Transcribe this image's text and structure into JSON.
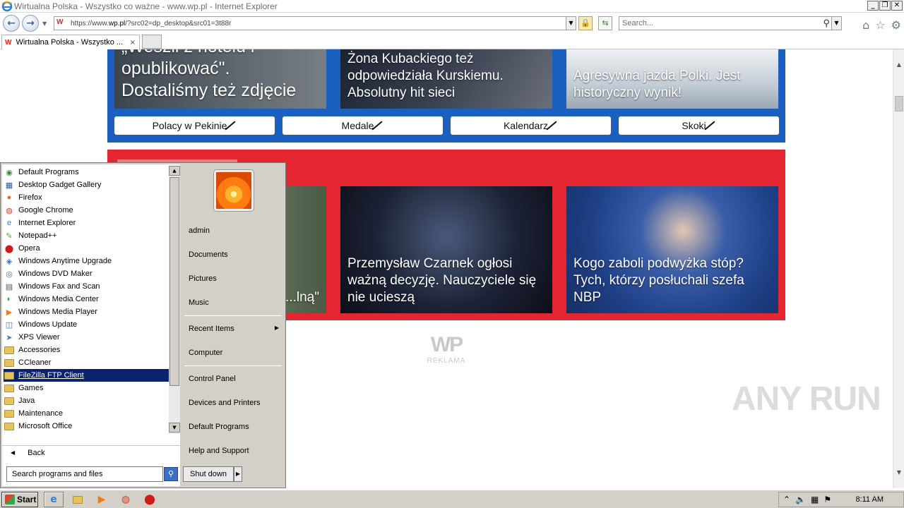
{
  "window": {
    "title": "Wirtualna Polska - Wszystko co ważne - www.wp.pl - Internet Explorer",
    "minimize": "_",
    "maximize": "❐",
    "close": "✕"
  },
  "address": {
    "url_prefix": "https://www.",
    "url_domain": "wp.pl",
    "url_rest": "/?src02=dp_desktop&src01=3t88r"
  },
  "search": {
    "placeholder": "Search..."
  },
  "tab": {
    "title": "Wirtualna Polska - Wszystko ...",
    "close": "×",
    "favicon": "W"
  },
  "page": {
    "sport_cards": [
      {
        "caption": "„Weszli z hotelu i opublikować\". Dostaliśmy też zdjęcie"
      },
      {
        "caption": "Żona Kubackiego też odpowiedziała Kurskiemu. Absolutny hit sieci"
      },
      {
        "caption": "Agresywna jazda Polki. Jest historyczny wynik!"
      }
    ],
    "pills": [
      "Polacy w Pekinie",
      "Medale",
      "Kalendarz",
      "Skoki"
    ],
    "news_cards": [
      {
        "caption": "...nę. ...lną\""
      },
      {
        "caption": "Przemysław Czarnek ogłosi ważną decyzję. Nauczyciele się nie ucieszą"
      },
      {
        "caption": "Kogo zaboli podwyżka stóp? Tych, którzy posłuchali szefa NBP"
      }
    ],
    "ad_logo": "WP",
    "ad_label": "REKLAMA"
  },
  "watermark": "ANY RUN",
  "start_menu": {
    "programs": [
      {
        "label": "Default Programs",
        "icon": "default-programs-icon"
      },
      {
        "label": "Desktop Gadget Gallery",
        "icon": "gadget-icon"
      },
      {
        "label": "Firefox",
        "icon": "firefox-icon"
      },
      {
        "label": "Google Chrome",
        "icon": "chrome-icon"
      },
      {
        "label": "Internet Explorer",
        "icon": "ie-icon"
      },
      {
        "label": "Notepad++",
        "icon": "notepadpp-icon"
      },
      {
        "label": "Opera",
        "icon": "opera-icon"
      },
      {
        "label": "Windows Anytime Upgrade",
        "icon": "windows-icon"
      },
      {
        "label": "Windows DVD Maker",
        "icon": "dvd-icon"
      },
      {
        "label": "Windows Fax and Scan",
        "icon": "fax-icon"
      },
      {
        "label": "Windows Media Center",
        "icon": "media-center-icon"
      },
      {
        "label": "Windows Media Player",
        "icon": "media-player-icon"
      },
      {
        "label": "Windows Update",
        "icon": "update-icon"
      },
      {
        "label": "XPS Viewer",
        "icon": "xps-icon"
      },
      {
        "label": "Accessories",
        "icon": "folder-icon"
      },
      {
        "label": "CCleaner",
        "icon": "folder-icon"
      },
      {
        "label": "FileZilla FTP Client",
        "icon": "folder-icon"
      },
      {
        "label": "Games",
        "icon": "folder-icon"
      },
      {
        "label": "Java",
        "icon": "folder-icon"
      },
      {
        "label": "Maintenance",
        "icon": "folder-icon"
      },
      {
        "label": "Microsoft Office",
        "icon": "folder-icon"
      }
    ],
    "selected_program": "FileZilla FTP Client",
    "back_label": "Back",
    "search_placeholder": "Search programs and files",
    "right_items": {
      "admin": "admin",
      "documents": "Documents",
      "pictures": "Pictures",
      "music": "Music",
      "recent": "Recent Items",
      "computer": "Computer",
      "control_panel": "Control Panel",
      "devices": "Devices and Printers",
      "default_programs": "Default Programs",
      "help": "Help and Support"
    },
    "shutdown_label": "Shut down"
  },
  "taskbar": {
    "start_label": "Start",
    "clock": "8:11 AM"
  }
}
